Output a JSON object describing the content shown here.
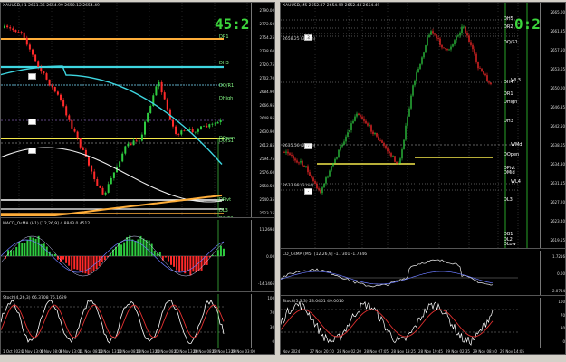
{
  "left_chart": {
    "header": "XAUUSD,H1  2651.36 2654.99 2650.12 2654.49",
    "timer": "45:21",
    "price_ticks": [
      "2790.00",
      "2772.50",
      "2754.25",
      "2738.60",
      "2720.75",
      "2702.70",
      "2684.90",
      "2666.95",
      "2648.95",
      "2630.90",
      "2612.85",
      "2594.75",
      "2576.60",
      "2558.50",
      "2540.35",
      "2523.15"
    ],
    "levels": [
      "DR1",
      "DH3",
      "DQ/R1",
      "DHigh",
      "DQpen",
      "DQ/S1",
      "DPivt",
      "DL3",
      "DQ/S1"
    ],
    "pills": [
      "",
      "",
      ""
    ],
    "bullets": [
      "",
      "",
      ""
    ],
    "macd_header": "MACD_OsMA (H1) [12,26,9]  4.8843 0.4512",
    "macd_ticks": [
      "11.2694",
      "0.00",
      "-14.1466"
    ],
    "stoch_header": "Stoch(4,26,3)  66.3708 76.1629",
    "stoch_ticks": [
      "100",
      "70",
      "30",
      "0"
    ],
    "xlabels": [
      "1 Oct 2024",
      "1 Nov 13:00",
      "6 Nov 08:00",
      "8 Nov 13:00",
      "11 Nov 08:00",
      "13 Nov 13:00",
      "18 Nov 08:00",
      "19 Nov 13:00",
      "20 Nov 08:00",
      "21 Nov 13:00",
      "26 Nov 08:00",
      "27 Nov 13:00",
      "29 Nov 03:00"
    ]
  },
  "right_chart": {
    "header": "XAUUSD,M5  2652.87 2654.99 2652.43 2654.49",
    "timer": "0:21",
    "price_ticks": [
      "2665.00",
      "2661.35",
      "2657.50",
      "2653.65",
      "2650.00",
      "2646.35",
      "2642.50",
      "2638.65",
      "2634.80",
      "2631.15",
      "2627.20",
      "2623.40",
      "2619.55"
    ],
    "levels": [
      "DH5",
      "DR2",
      "DQ/S1",
      "DH4",
      "WL3",
      "DR1",
      "DHigh",
      "DH3",
      "WMd",
      "DOpen",
      "DPivt",
      "DMid",
      "WL4",
      "DL3",
      "DB1",
      "DL2",
      "DLow"
    ],
    "boxes": [
      "3",
      "-",
      "-"
    ],
    "bullets": [
      "2658.25 (3 min)",
      "2635.56 (2 min)",
      "2633.98 (3 bis)"
    ],
    "macd_header": "CD_OsMA (M5) [12,26,9]  -1.7301 -1.7346",
    "macd_ticks": [
      "1.7216",
      "0.00",
      "-2.0734"
    ],
    "stoch_header": "Stoch(5,3,3)  23.0451 49.0010",
    "stoch_ticks": [
      "100",
      "70",
      "30",
      "0"
    ],
    "xlabels": [
      "Nov 2024",
      "27 Nov 20:10",
      "28 Nov 02:20",
      "28 Nov 07:05",
      "28 Nov 13:25",
      "28 Nov 19:45",
      "29 Nov 02:35",
      "29 Nov 08:40",
      "29 Nov 14:05"
    ]
  },
  "colors": {
    "up_candle": "#2ecc40",
    "down_candle": "#ff2a2a",
    "ma_cyan": "#3ed6e0",
    "ma_orange": "#ffae3a",
    "level_yellow": "#f4e84a",
    "timer_green": "#3cd43c"
  }
}
